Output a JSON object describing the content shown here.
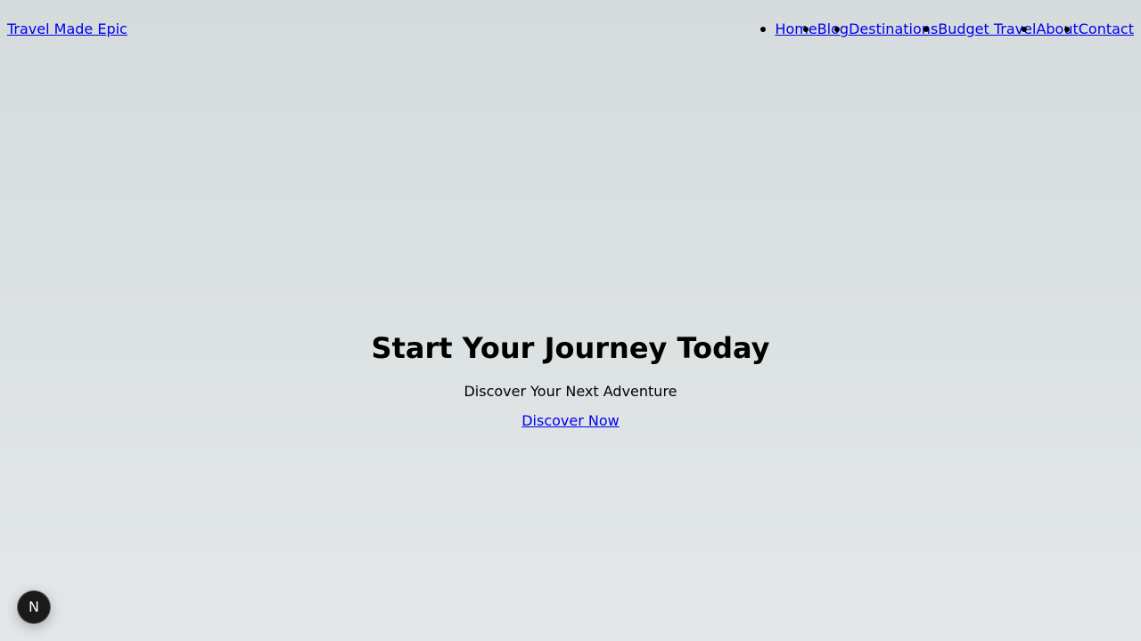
{
  "header": {
    "brand": "Travel Made Epic",
    "nav": [
      {
        "label": "Home"
      },
      {
        "label": "Blog"
      },
      {
        "label": "Destinations"
      },
      {
        "label": "Budget Travel"
      },
      {
        "label": "About"
      },
      {
        "label": "Contact"
      }
    ]
  },
  "hero": {
    "title": "Start Your Journey Today",
    "subtitle": "Discover Your Next Adventure",
    "cta": "Discover Now"
  },
  "dev_badge": {
    "letter": "N",
    "icon": "nextjs-logo-icon"
  }
}
